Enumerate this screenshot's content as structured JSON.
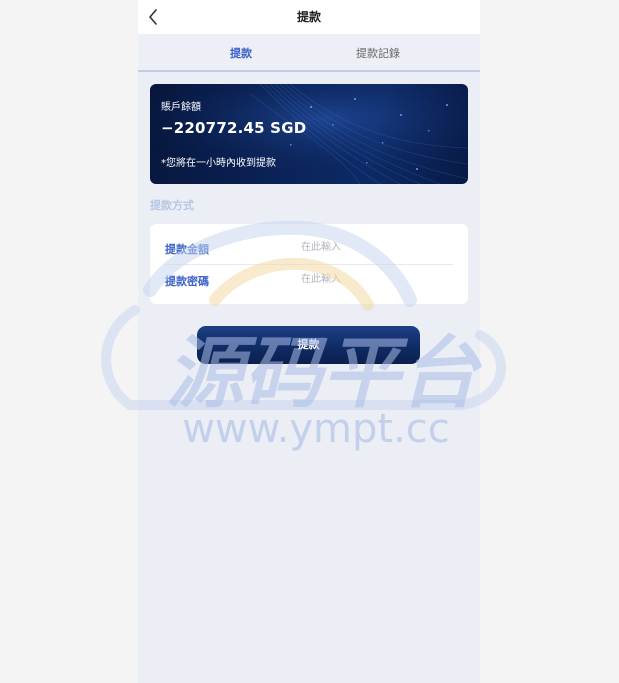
{
  "header": {
    "title": "提款"
  },
  "tabs": [
    {
      "label": "提款",
      "active": true
    },
    {
      "label": "提款記錄",
      "active": false
    }
  ],
  "balance": {
    "label": "賬戶餘額",
    "amount": "−220772.45 SGD",
    "note": "*您將在一小時內收到提款"
  },
  "form": {
    "section_title": "提款方式",
    "fields": [
      {
        "label": "提款金額",
        "placeholder": "在此輸入",
        "value": ""
      },
      {
        "label": "提款密碼",
        "placeholder": "在此輸入",
        "value": ""
      }
    ]
  },
  "submit": {
    "label": "提款"
  },
  "watermark": {
    "brand": "源码平台",
    "url": "www.ympt.cc"
  },
  "colors": {
    "accent": "#3d63c8",
    "card_dark": "#0b2358",
    "page_bg": "#ebeef4"
  }
}
